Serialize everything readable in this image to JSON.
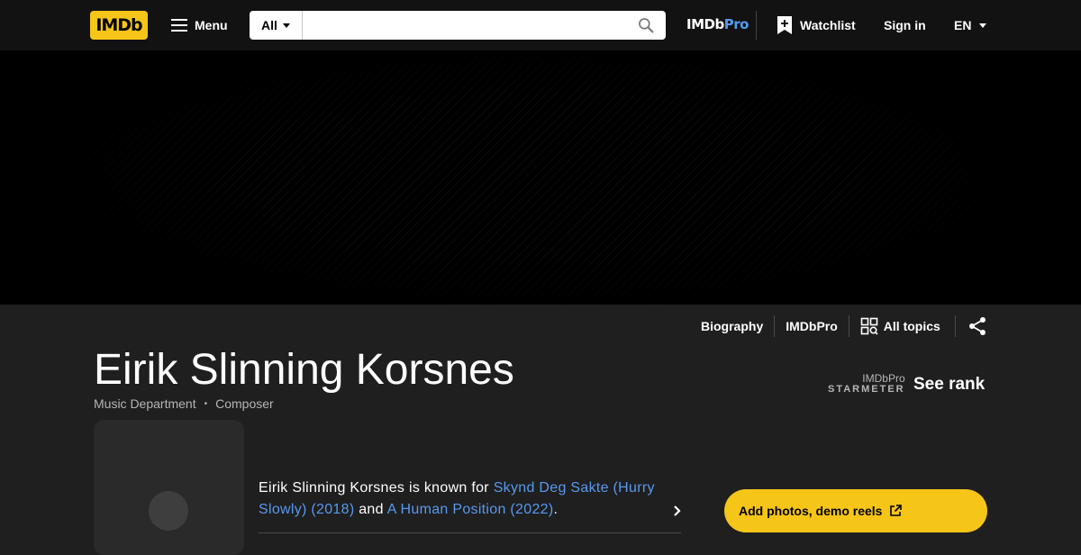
{
  "nav": {
    "logo": "IMDb",
    "menu_label": "Menu",
    "search_category": "All",
    "search_placeholder": "",
    "pro_logo_main": "IMDb",
    "pro_logo_accent": "Pro",
    "watchlist_label": "Watchlist",
    "signin_label": "Sign in",
    "language": "EN"
  },
  "subnav": {
    "biography": "Biography",
    "imdbpro": "IMDbPro",
    "all_topics": "All topics"
  },
  "person": {
    "name": "Eirik Slinning Korsnes",
    "roles": [
      "Music Department",
      "Composer"
    ],
    "known_for_prefix": "Eirik Slinning Korsnes is known for",
    "known_for": [
      {
        "title": "Skynd Deg Sakte (Hurry Slowly) (2018)"
      },
      {
        "title": "A Human Position (2022)"
      }
    ],
    "known_for_joiner": "and",
    "known_for_suffix": "."
  },
  "starmeter": {
    "small": "IMDbPro",
    "label": "STARMETER",
    "see_rank": "See rank"
  },
  "actions": {
    "add_photos": "Add photos, demo reels"
  },
  "colors": {
    "brand_yellow": "#f5c518",
    "link_blue": "#5799ef",
    "nav_bg": "#121212",
    "page_bg": "#1f1f1f"
  }
}
